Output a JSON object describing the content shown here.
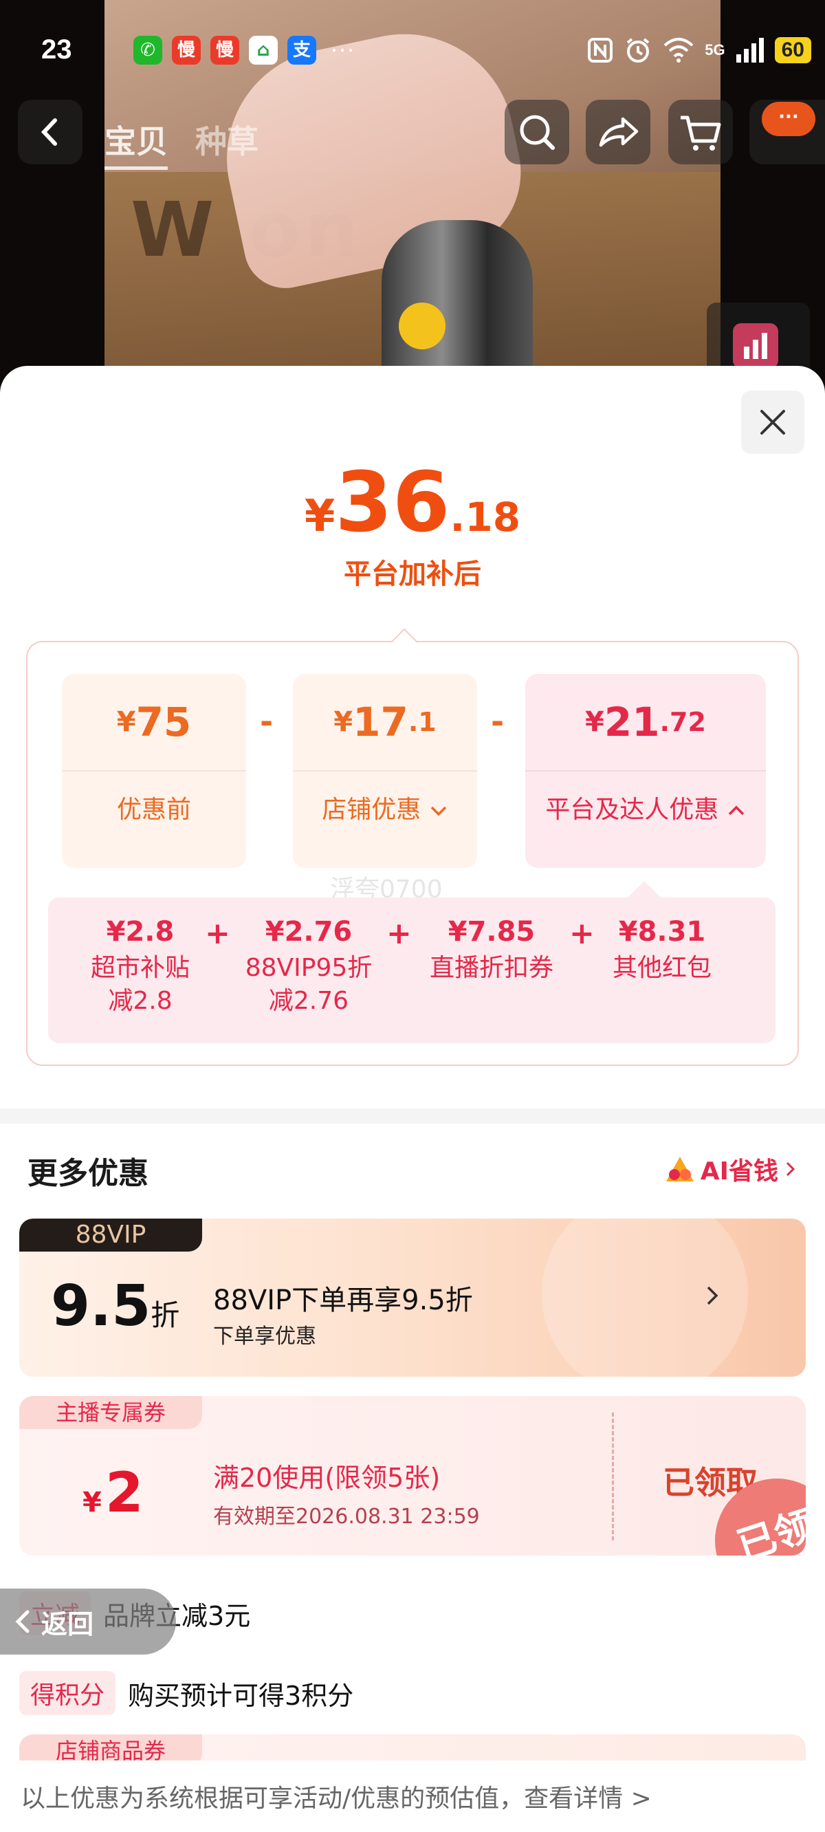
{
  "status_bar": {
    "time": "23",
    "more": "···",
    "battery": "60",
    "network": "5G"
  },
  "app_icons": [
    {
      "name": "wechat-icon",
      "glyph": "✆",
      "color": "#1fb82a"
    },
    {
      "name": "man-app-icon",
      "glyph": "慢",
      "color": "#ea3b2a"
    },
    {
      "name": "man-app-icon-2",
      "glyph": "慢",
      "color": "#ea3b2a"
    },
    {
      "name": "home-app-icon",
      "glyph": "⌂",
      "color": "#ffffff"
    },
    {
      "name": "alipay-icon",
      "glyph": "支",
      "color": "#1677ff"
    }
  ],
  "nav": {
    "tab_baobei": "宝贝",
    "tab_zhongcao": "种草",
    "message_badge": "···"
  },
  "price": {
    "symbol": "¥",
    "integer": "36",
    "decimal": ".18",
    "caption": "平台加补后"
  },
  "breakdown": {
    "original": {
      "symbol": "¥",
      "integer": "75",
      "decimal": "",
      "label": "优惠前"
    },
    "shop": {
      "symbol": "¥",
      "integer": "17",
      "decimal": ".1",
      "label": "店铺优惠"
    },
    "platform": {
      "symbol": "¥",
      "integer": "21",
      "decimal": ".72",
      "label": "平台及达人优惠"
    },
    "operator_minus": "-",
    "operator_plus": "+",
    "watermark": "浮夸0700",
    "items": [
      {
        "value": "¥2.8",
        "name": "超市补贴",
        "detail": "减2.8"
      },
      {
        "value": "¥2.76",
        "name": "88VIP95折",
        "detail": "减2.76"
      },
      {
        "value": "¥7.85",
        "name": "直播折扣券",
        "detail": ""
      },
      {
        "value": "¥8.31",
        "name": "其他红包",
        "detail": ""
      }
    ]
  },
  "more": {
    "title": "更多优惠",
    "ai_link": "AI省钱"
  },
  "vip_card": {
    "tag": "88VIP",
    "discount": "9.5",
    "unit": "折",
    "title": "88VIP下单再享9.5折",
    "subtitle": "下单享优惠"
  },
  "coupon": {
    "tag": "主播专属券",
    "symbol": "¥",
    "amount": "2",
    "title": "满20使用(限领5张)",
    "expiry": "有效期至2026.08.31 23:59",
    "status": "已领取",
    "stamp": "已领"
  },
  "rows": {
    "brand_tag": "立减",
    "brand_text": "品牌立减3元",
    "points_tag": "得积分",
    "points_text": "购买预计可得3积分"
  },
  "back_button": "返回",
  "shop_coupon_tag": "店铺商品券",
  "footer_note": "以上优惠为系统根据可享活动/优惠的预估值，查看详情 >",
  "colors": {
    "accent_orange": "#f04e10",
    "accent_red": "#e5284a"
  }
}
